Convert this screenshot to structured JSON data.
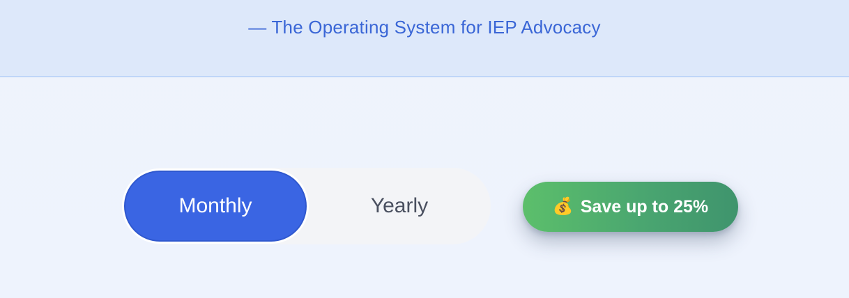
{
  "header": {
    "tagline": "— The Operating System for IEP Advocacy"
  },
  "billing_toggle": {
    "options": [
      {
        "label": "Monthly",
        "selected": true
      },
      {
        "label": "Yearly",
        "selected": false
      }
    ]
  },
  "promo_badge": {
    "icon": "money-bag-icon",
    "icon_glyph": "💰",
    "text": "Save up to 25%"
  },
  "colors": {
    "accent": "#3a65e3",
    "tagline": "#3a66d6",
    "badge_start": "#5cbf6b",
    "badge_end": "#3f946d"
  }
}
